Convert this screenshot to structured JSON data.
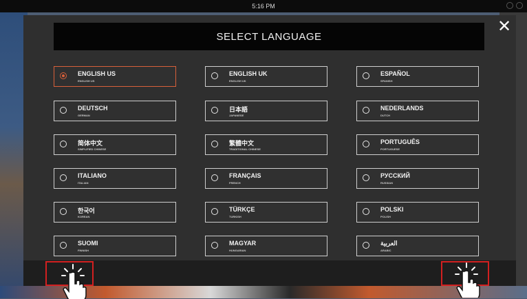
{
  "status_bar": {
    "time": "5:16 PM"
  },
  "dialog": {
    "title": "SELECT LANGUAGE",
    "close_symbol": "✕",
    "languages": [
      {
        "name": "ENGLISH US",
        "sub": "ENGLISH US",
        "selected": true
      },
      {
        "name": "ENGLISH UK",
        "sub": "ENGLISH UK",
        "selected": false
      },
      {
        "name": "ESPAÑOL",
        "sub": "SPANISH",
        "selected": false
      },
      {
        "name": "DEUTSCH",
        "sub": "GERMAN",
        "selected": false
      },
      {
        "name": "日本語",
        "sub": "JAPANESE",
        "selected": false
      },
      {
        "name": "NEDERLANDS",
        "sub": "DUTCH",
        "selected": false
      },
      {
        "name": "简体中文",
        "sub": "SIMPLIFIED CHINESE",
        "selected": false
      },
      {
        "name": "繁體中文",
        "sub": "TRADITIONAL CHINESE",
        "selected": false
      },
      {
        "name": "PORTUGUÊS",
        "sub": "PORTUGUESE",
        "selected": false
      },
      {
        "name": "ITALIANO",
        "sub": "ITALIAN",
        "selected": false
      },
      {
        "name": "FRANÇAIS",
        "sub": "FRENCH",
        "selected": false
      },
      {
        "name": "РУССКИЙ",
        "sub": "RUSSIAN",
        "selected": false
      },
      {
        "name": "한국어",
        "sub": "KOREAN",
        "selected": false
      },
      {
        "name": "TÜRKÇE",
        "sub": "TURKISH",
        "selected": false
      },
      {
        "name": "POLSKI",
        "sub": "POLISH",
        "selected": false
      },
      {
        "name": "SUOMI",
        "sub": "FINNISH",
        "selected": false
      },
      {
        "name": "MAGYAR",
        "sub": "HUNGARIAN",
        "selected": false
      },
      {
        "name": "العربية",
        "sub": "ARABIC",
        "selected": false
      }
    ]
  },
  "colors": {
    "accent": "#d9603a",
    "highlight": "#d32020",
    "dialog_bg": "#2f2f2f"
  },
  "icons": {
    "close": "close-icon",
    "tap_left": "tap-hand-icon",
    "tap_right": "tap-hand-icon"
  }
}
